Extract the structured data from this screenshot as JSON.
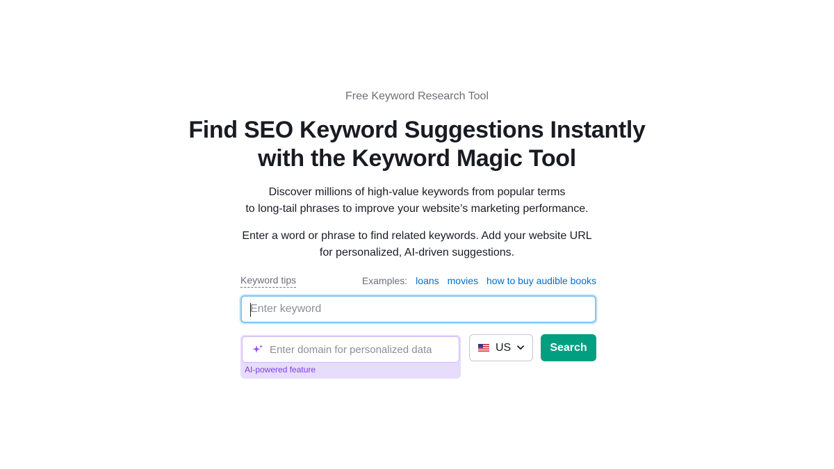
{
  "hero": {
    "eyebrow": "Free Keyword Research Tool",
    "title_line1": "Find SEO Keyword Suggestions Instantly",
    "title_line2": "with the Keyword Magic Tool",
    "lede_line1": "Discover millions of high-value keywords from popular terms",
    "lede_line2": "to long-tail phrases to improve your website’s marketing performance.",
    "instructions_line1": "Enter a word or phrase to find related keywords. Add your website URL",
    "instructions_line2": "for personalized, AI-driven suggestions."
  },
  "tips": {
    "keyword_tips_label": "Keyword tips",
    "examples_label": "Examples:",
    "examples": [
      "loans",
      "movies",
      "how to buy audible books"
    ]
  },
  "keyword_input": {
    "value": "",
    "placeholder": "Enter keyword"
  },
  "domain_input": {
    "value": "",
    "placeholder": "Enter domain for personalized data",
    "note": "AI-powered feature",
    "icon": "sparkle-icon"
  },
  "country_select": {
    "selected": "US",
    "flag_icon": "us-flag-icon"
  },
  "search_button": {
    "label": "Search"
  },
  "colors": {
    "accent_green": "#009f81",
    "link_blue": "#006dca",
    "ai_purple": "#7a3ee0",
    "ai_bg": "#e8dcfd",
    "focus_blue": "#7ec6f5"
  }
}
